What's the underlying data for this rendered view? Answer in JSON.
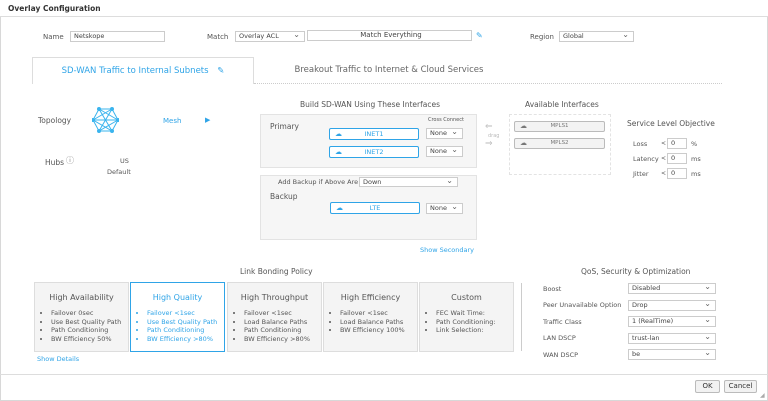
{
  "window": {
    "title": "Overlay Configuration"
  },
  "form": {
    "name_label": "Name",
    "name_value": "Netskope",
    "match_label": "Match",
    "match_value": "Overlay ACL",
    "match_text": "Match Everything",
    "region_label": "Region",
    "region_value": "Global"
  },
  "tabs": [
    {
      "label": "SD-WAN Traffic to Internal Subnets",
      "active": true
    },
    {
      "label": "Breakout Traffic to Internet & Cloud Services",
      "active": false
    }
  ],
  "topology": {
    "label": "Topology",
    "value": "Mesh",
    "hubs_label": "Hubs",
    "hubs": [
      "US",
      "Default"
    ]
  },
  "build": {
    "title": "Build SD-WAN Using These Interfaces",
    "primary_label": "Primary",
    "cross_connect_label": "Cross Connect",
    "primary": [
      {
        "name": "INET1",
        "cross": "None"
      },
      {
        "name": "INET2",
        "cross": "None"
      }
    ],
    "backup_condition_label": "Add Backup if Above Are",
    "backup_condition": "Down",
    "backup_label": "Backup",
    "backup": [
      {
        "name": "LTE",
        "cross": "None"
      }
    ],
    "show_secondary": "Show Secondary",
    "drag_label": "drag"
  },
  "available": {
    "title": "Available Interfaces",
    "items": [
      "MPLS1",
      "MPLS2"
    ]
  },
  "slo": {
    "title": "Service Level Objective",
    "rows": [
      {
        "label": "Loss",
        "op": "<",
        "value": "0",
        "unit": "%"
      },
      {
        "label": "Latency",
        "op": "<",
        "value": "0",
        "unit": "ms"
      },
      {
        "label": "Jitter",
        "op": "<",
        "value": "0",
        "unit": "ms"
      }
    ]
  },
  "bonding": {
    "title": "Link Bonding Policy",
    "show_details": "Show Details",
    "selected": "High Quality",
    "cards": [
      {
        "title": "High Availability",
        "items": [
          "Failover 0sec",
          "Use Best Quality Path",
          "Path Conditioning",
          "BW Efficiency 50%"
        ]
      },
      {
        "title": "High Quality",
        "items": [
          "Failover <1sec",
          "Use Best Quality Path",
          "Path Conditioning",
          "BW Efficiency >80%"
        ]
      },
      {
        "title": "High Throughput",
        "items": [
          "Failover <1sec",
          "Load Balance Paths",
          "Path Conditioning",
          "BW Efficiency >80%"
        ]
      },
      {
        "title": "High Efficiency",
        "items": [
          "Failover <1sec",
          "Load Balance Paths",
          "BW Efficiency 100%"
        ]
      },
      {
        "title": "Custom",
        "items": [
          "FEC Wait Time:",
          "Path Conditioning:",
          "Link Selection:"
        ]
      }
    ]
  },
  "qos": {
    "title": "QoS, Security & Optimization",
    "rows": [
      {
        "label": "Boost",
        "value": "Disabled"
      },
      {
        "label": "Peer Unavailable Option",
        "value": "Drop"
      },
      {
        "label": "Traffic Class",
        "value": "1 (RealTime)"
      },
      {
        "label": "LAN DSCP",
        "value": "trust-lan"
      },
      {
        "label": "WAN DSCP",
        "value": "be"
      }
    ]
  },
  "buttons": {
    "ok": "OK",
    "cancel": "Cancel"
  },
  "colors": {
    "accent": "#2fa4e7"
  }
}
